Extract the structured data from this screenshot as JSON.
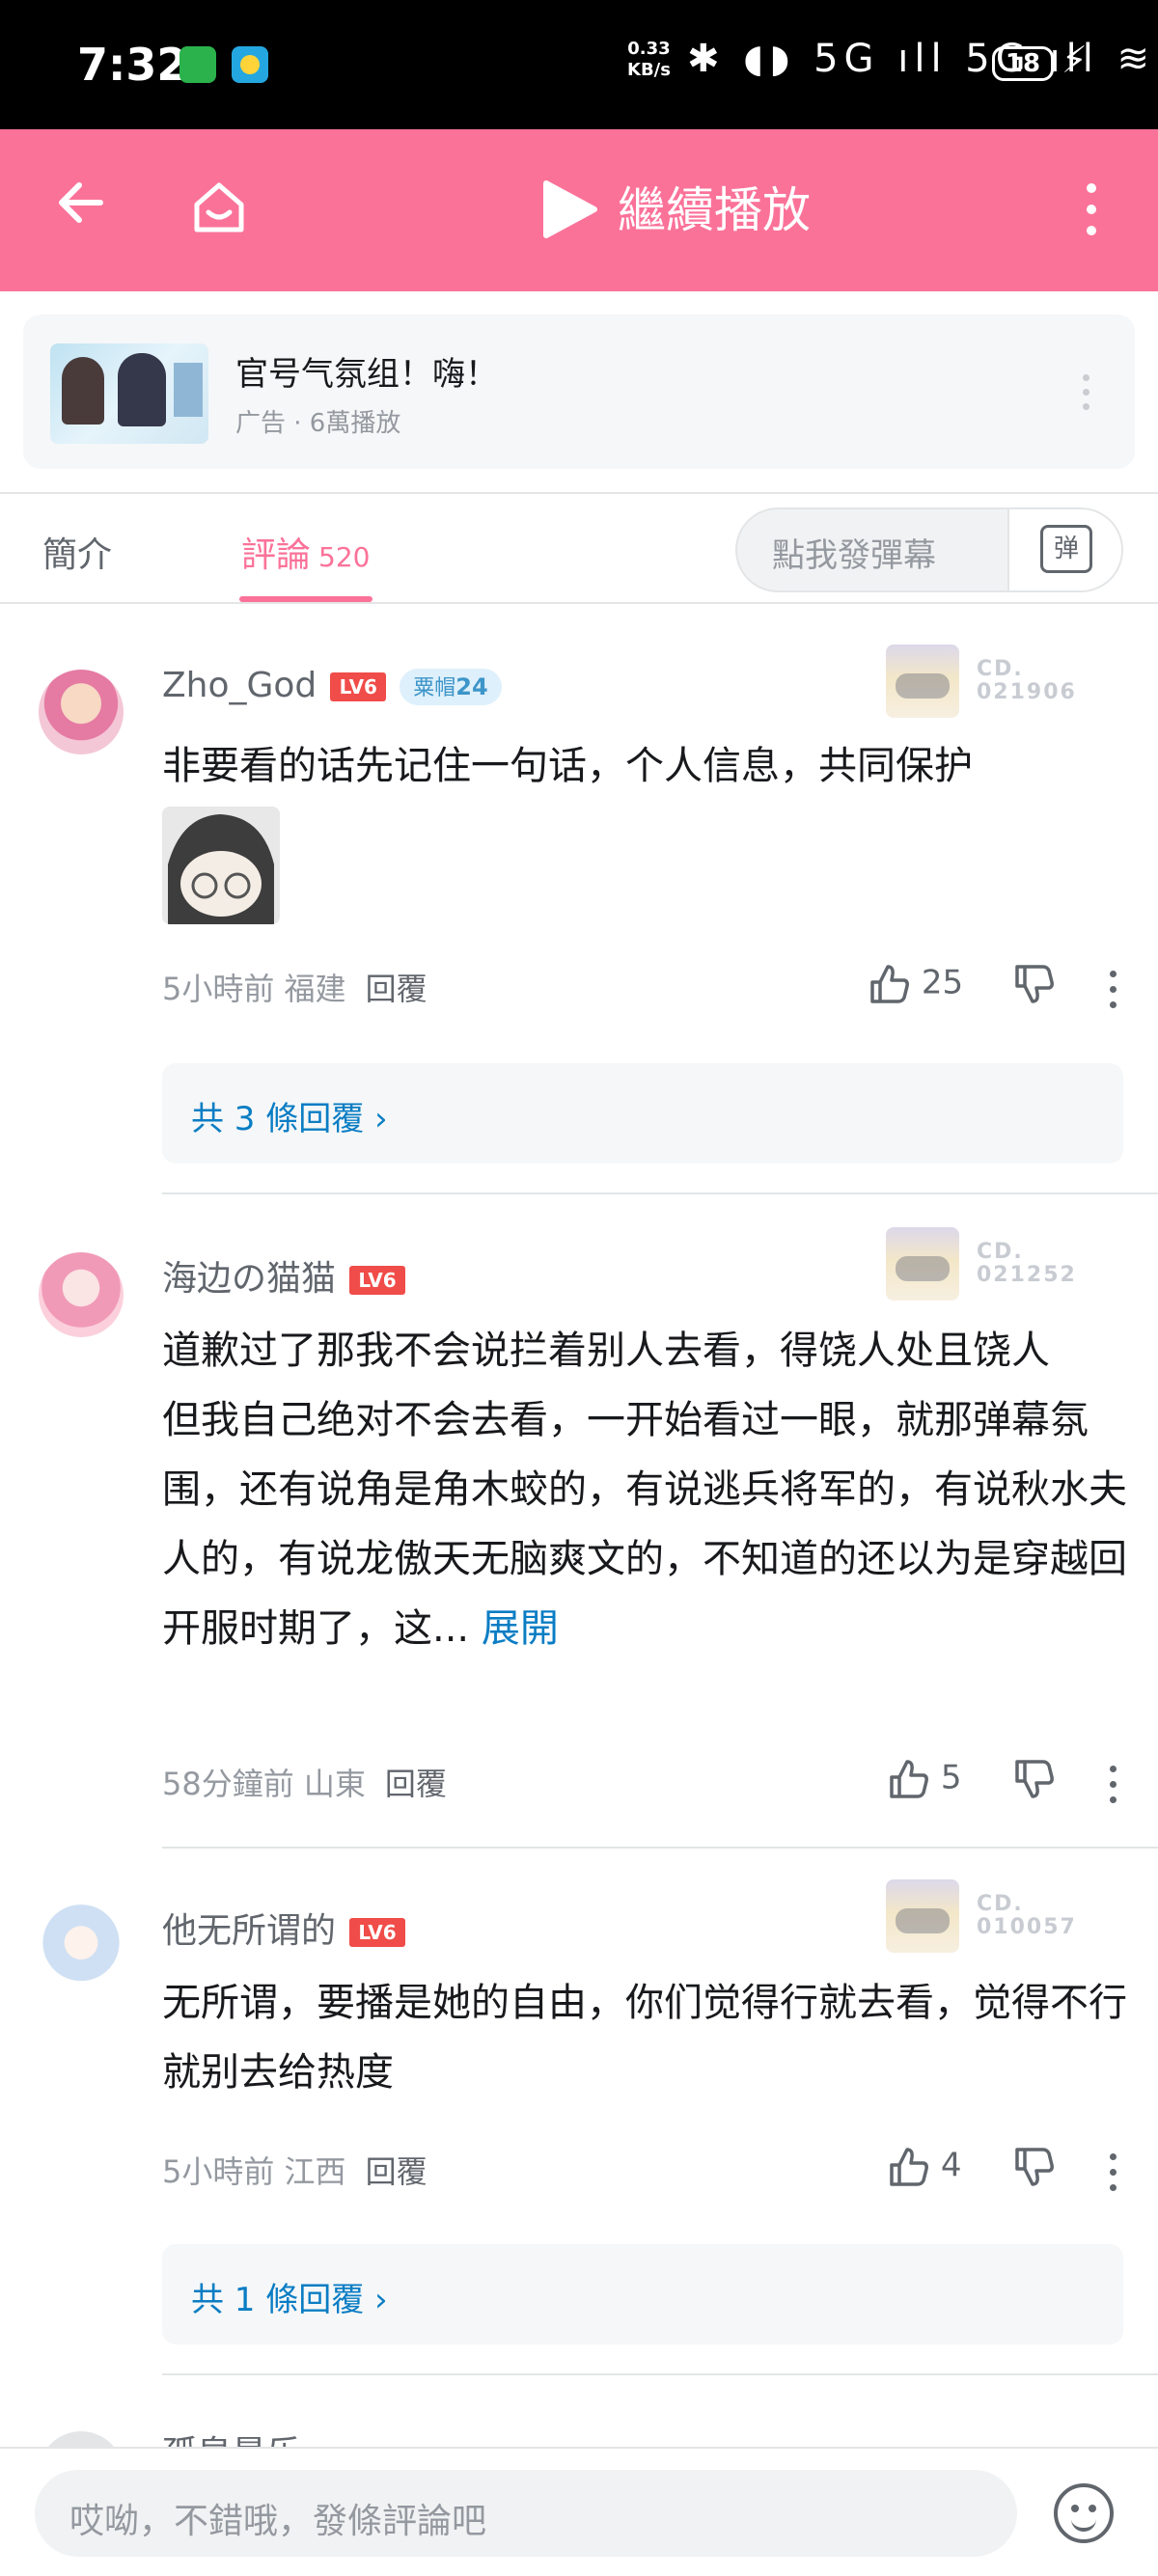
{
  "status_bar": {
    "time": "7:32",
    "net_speed_value": "0.33",
    "net_speed_unit": "KB/s",
    "signal_icons": "✱ ◖◗ 5G ıll 5G ıll ≋",
    "battery": "18"
  },
  "header": {
    "title": "繼續播放"
  },
  "ad": {
    "title": "官号气氛组！嗨！",
    "subtitle": "广告 · 6萬播放"
  },
  "tabs": {
    "intro": "簡介",
    "comments": "評論",
    "comments_count": "520",
    "danmaku_placeholder": "點我發彈幕",
    "danmaku_button": "弹"
  },
  "comments": [
    {
      "username": "Zho_God",
      "level": "LV6",
      "medal_name": "粟帽",
      "medal_level": "24",
      "fan_number_prefix": "CD.",
      "fan_number": "021906",
      "content": "非要看的话先记住一句话，个人信息，共同保护",
      "time": "5小時前",
      "location": "福建",
      "reply_label": "回覆",
      "likes": "25",
      "sub_replies": "共 3 條回覆 ›"
    },
    {
      "username": "海边の猫猫",
      "level": "LV6",
      "fan_number_prefix": "CD.",
      "fan_number": "021252",
      "content": "道歉过了那我不会说拦着别人去看，得饶人处且饶人\n但我自己绝对不会去看，一开始看过一眼，就那弹幕氛围，还有说角是角木蛟的，有说逃兵将军的，有说秋水夫人的，有说龙傲天无脑爽文的，不知道的还以为是穿越回开服时期了，这...",
      "expand_label": "展開",
      "time": "58分鐘前",
      "location": "山東",
      "reply_label": "回覆",
      "likes": "5"
    },
    {
      "username": "他无所谓的",
      "level": "LV6",
      "fan_number_prefix": "CD.",
      "fan_number": "010057",
      "content": "无所谓，要播是她的自由，你们觉得行就去看，觉得不行就别去给热度",
      "time": "5小時前",
      "location": "江西",
      "reply_label": "回覆",
      "likes": "4",
      "sub_replies": "共 1 條回覆 ›"
    }
  ],
  "peek_comment": {
    "username": "孤泉最乐"
  },
  "bottom_bar": {
    "input_placeholder": "哎呦，不錯哦，發條評論吧"
  },
  "colors": {
    "brand_pink": "#fb7299",
    "link_blue": "#0a7dc4",
    "level_red": "#f04c49"
  },
  "icons": [
    "back-arrow-icon",
    "home-icon",
    "play-icon",
    "more-vertical-icon",
    "thumbs-up-icon",
    "thumbs-down-icon",
    "emoji-icon",
    "danmaku-icon"
  ]
}
